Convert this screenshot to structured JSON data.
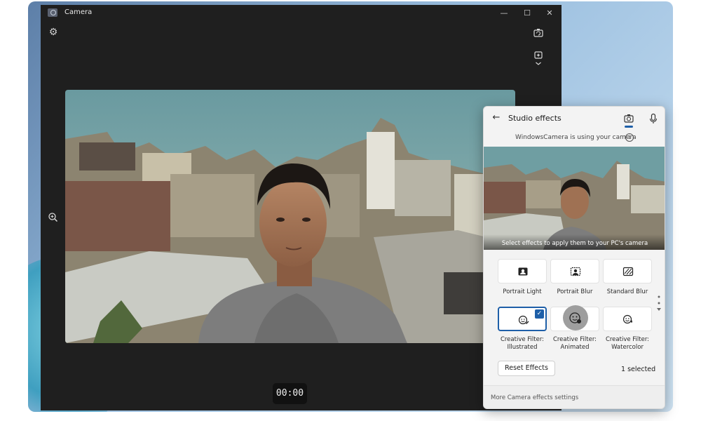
{
  "window": {
    "title": "Camera",
    "controls": {
      "minimize": "—",
      "maximize": "☐",
      "close": "✕"
    },
    "settings_icon": "⚙"
  },
  "recording": {
    "timer": "00:00"
  },
  "studio_effects": {
    "title": "Studio effects",
    "back_icon": "←",
    "status": "WindowsCamera is using your camera",
    "info_icon": "i",
    "preview_caption": "Select effects to apply them to your PC's camera",
    "effects": [
      {
        "label": "Portrait Light",
        "icon": "portrait-light-icon",
        "selected": false
      },
      {
        "label": "Portrait Blur",
        "icon": "portrait-blur-icon",
        "selected": false
      },
      {
        "label": "Standard Blur",
        "icon": "standard-blur-icon",
        "selected": false
      },
      {
        "label": "Creative Filter: Illustrated",
        "icon": "illustrated-filter-icon",
        "selected": true
      },
      {
        "label": "Creative Filter: Animated",
        "icon": "animated-filter-icon",
        "selected": false
      },
      {
        "label": "Creative Filter: Watercolor",
        "icon": "watercolor-filter-icon",
        "selected": false
      }
    ],
    "check_mark": "✓",
    "reset_label": "Reset Effects",
    "selected_count": "1 selected",
    "more_settings": "More Camera effects settings"
  },
  "colors": {
    "accent": "#1e5fa8",
    "window_bg": "#1f1f1f",
    "panel_bg": "#f3f3f3"
  }
}
